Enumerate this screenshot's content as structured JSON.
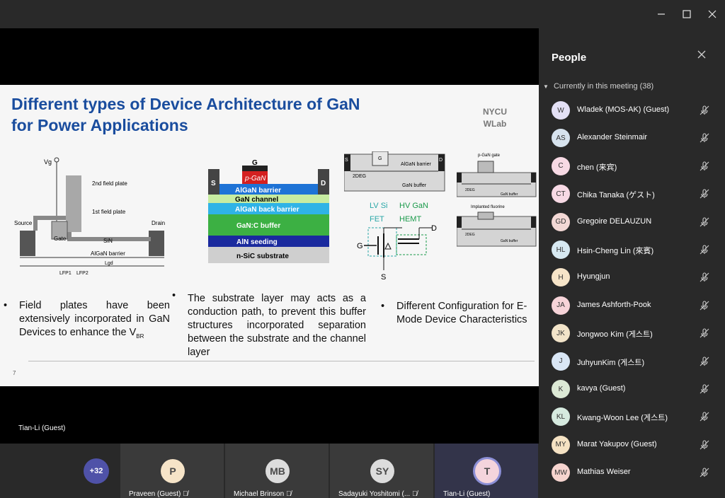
{
  "window": {
    "min_icon": "minimize-icon",
    "max_icon": "maximize-icon",
    "close_icon": "close-icon"
  },
  "slide": {
    "title_line1": "Different types of Device Architecture of GaN",
    "title_line2": "for Power Applications",
    "brand_line1": "NYCU",
    "brand_line2": "WLab",
    "bullets": [
      "Field plates have been extensively incorporated in GaN Devices to enhance the V",
      "The substrate layer may acts as a conduction path, to prevent this buffer structures incorporated separation between the substrate and the channel layer",
      "Different Configuration for E-Mode Device Characteristics"
    ],
    "bullet1_sub": "BR",
    "page_number": "7",
    "fig1": {
      "vg": "Vg",
      "fp2": "2nd field plate",
      "fp1": "1st field plate",
      "source": "Source",
      "drain": "Drain",
      "sin": "SiN",
      "gate": "Gate",
      "barrier": "AlGaN barrier",
      "lgd": "Lgd",
      "lfp1": "LFP1",
      "lfp2": "LFP2"
    },
    "fig2": {
      "g": "G",
      "pgan": "p-GaN",
      "s": "S",
      "d": "D",
      "layers": [
        "AlGaN barrier",
        "GaN channel",
        "AlGaN back barrier",
        "GaN:C buffer",
        "AlN seeding",
        "n-SiC substrate"
      ]
    },
    "fig3": {
      "s": "S",
      "g": "G",
      "d": "D",
      "deg": "2DEG",
      "barrier": "AlGaN barrier",
      "buffer": "GaN buffer",
      "lv": "LV Si",
      "fet": "FET",
      "hv": "HV GaN",
      "hemt": "HEMT",
      "cg": "G",
      "cd": "D",
      "cs": "S"
    },
    "fig4": {
      "pgan_gate": "p-GaN gate",
      "implanted": "Implanted fluorine"
    }
  },
  "speaker": "Tian-Li (Guest)",
  "strip": {
    "more": "+32",
    "tiles": [
      {
        "initials": "P",
        "name": "Praveen (Guest)"
      },
      {
        "initials": "MB",
        "name": "Michael Brinson"
      },
      {
        "initials": "SY",
        "name": "Sadayuki Yoshitomi (..."
      },
      {
        "initials": "T",
        "name": "Tian-Li (Guest)"
      }
    ]
  },
  "panel": {
    "title": "People",
    "section": "Currently in this meeting (38)",
    "people": [
      {
        "initials": "W",
        "name": "Wladek (MOS-AK) (Guest)",
        "color": "#e3e0f5"
      },
      {
        "initials": "AS",
        "name": "Alexander Steinmair",
        "color": "#d7e3ee"
      },
      {
        "initials": "C",
        "name": "chen (来宾)",
        "color": "#f7d9e4"
      },
      {
        "initials": "CT",
        "name": "Chika Tanaka (ゲスト)",
        "color": "#f7d9e4"
      },
      {
        "initials": "GD",
        "name": "Gregoire DELAUZUN",
        "color": "#f3d8d5"
      },
      {
        "initials": "HL",
        "name": "Hsin-Cheng Lin (來賓)",
        "color": "#d7e9f2"
      },
      {
        "initials": "H",
        "name": "Hyungjun",
        "color": "#f6e4c8"
      },
      {
        "initials": "JA",
        "name": "James Ashforth-Pook",
        "color": "#f6d3d8"
      },
      {
        "initials": "JK",
        "name": "Jongwoo Kim (게스트)",
        "color": "#f2e4c9"
      },
      {
        "initials": "J",
        "name": "JuhyunKim (게스트)",
        "color": "#d9e6f5"
      },
      {
        "initials": "K",
        "name": "kavya (Guest)",
        "color": "#dce9d5"
      },
      {
        "initials": "KL",
        "name": "Kwang-Woon Lee (게스트)",
        "color": "#d6eadf"
      },
      {
        "initials": "MY",
        "name": "Marat Yakupov (Guest)",
        "color": "#f5e2c3"
      },
      {
        "initials": "MW",
        "name": "Mathias Weiser",
        "color": "#f6d4cf"
      }
    ]
  }
}
